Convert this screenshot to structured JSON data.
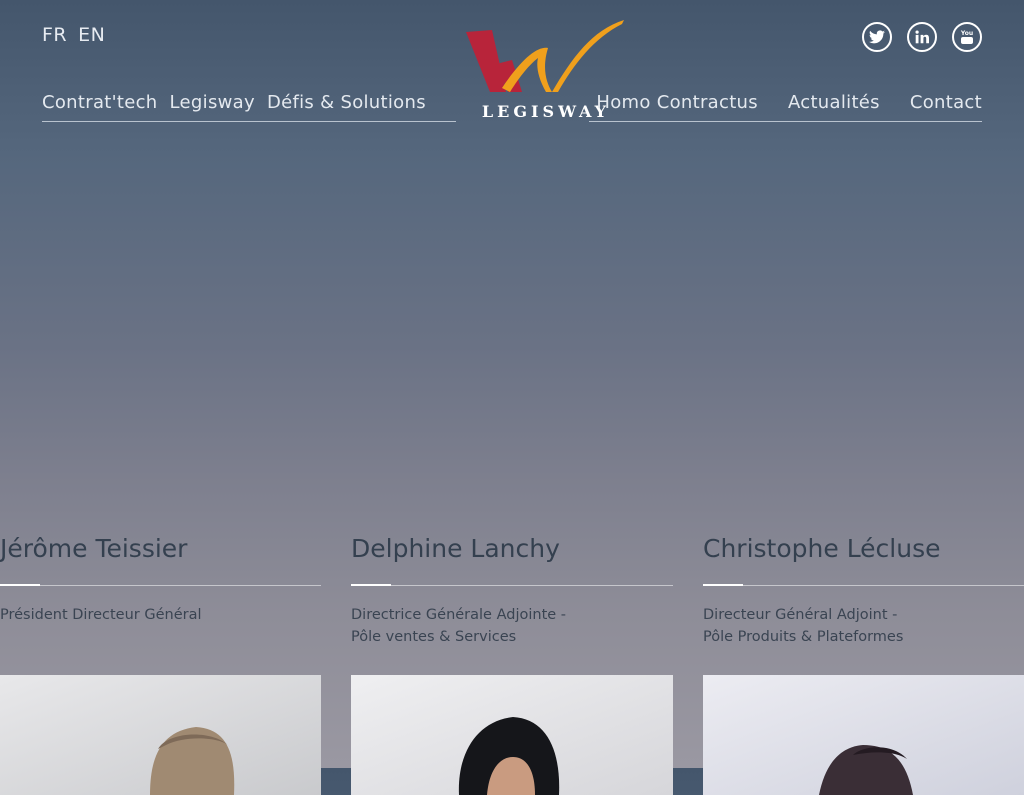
{
  "header": {
    "languages": [
      "FR",
      "EN"
    ],
    "logo_text": "LEGISWAY",
    "nav_left": [
      "Contrat'tech",
      "Legisway",
      "Défis & Solutions"
    ],
    "nav_right": [
      "Homo Contractus",
      "Actualités",
      "Contact"
    ],
    "social": [
      "twitter-icon",
      "linkedin-icon",
      "youtube-icon"
    ]
  },
  "team": [
    {
      "name": "Jérôme Teissier",
      "role_line1": "Président Directeur Général",
      "role_line2": ""
    },
    {
      "name": "Delphine Lanchy",
      "role_line1": "Directrice Générale Adjointe -",
      "role_line2": "Pôle ventes & Services"
    },
    {
      "name": "Christophe Lécluse",
      "role_line1": "Directeur Général Adjoint -",
      "role_line2": "Pôle Produits & Plateformes"
    }
  ],
  "colors": {
    "logo_red": "#b8243a",
    "logo_orange": "#f0a01c"
  }
}
